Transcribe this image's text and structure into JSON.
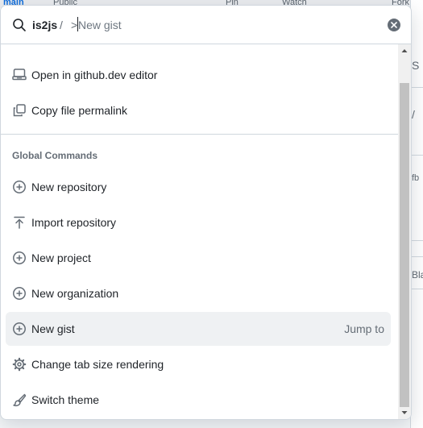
{
  "background": {
    "top_fragments": [
      "main",
      "Public",
      "Pin",
      "Watch",
      "Fork"
    ],
    "right_fragments": [
      "S",
      "/",
      "fb",
      "Bla"
    ]
  },
  "search": {
    "scope": "is2js",
    "separator": "/",
    "prefix": ">",
    "placeholder": "New gist",
    "clear_icon": "x-circle-icon"
  },
  "items": [
    {
      "label": "Open in github.dev editor",
      "icon": "code-editor-icon"
    },
    {
      "label": "Copy file permalink",
      "icon": "copy-icon"
    }
  ],
  "section_title": "Global Commands",
  "global_commands": [
    {
      "label": "New repository",
      "icon": "plus-circle-icon"
    },
    {
      "label": "Import repository",
      "icon": "upload-icon"
    },
    {
      "label": "New project",
      "icon": "plus-circle-icon"
    },
    {
      "label": "New organization",
      "icon": "plus-circle-icon"
    },
    {
      "label": "New gist",
      "icon": "plus-circle-icon",
      "hint": "Jump to",
      "active": true
    },
    {
      "label": "Change tab size rendering",
      "icon": "gear-icon"
    },
    {
      "label": "Switch theme",
      "icon": "paintbrush-icon"
    }
  ],
  "colors": {
    "accent": "#1f2328",
    "muted": "#656d76",
    "active_bg": "#eff1f3",
    "border": "#d0d7de"
  }
}
